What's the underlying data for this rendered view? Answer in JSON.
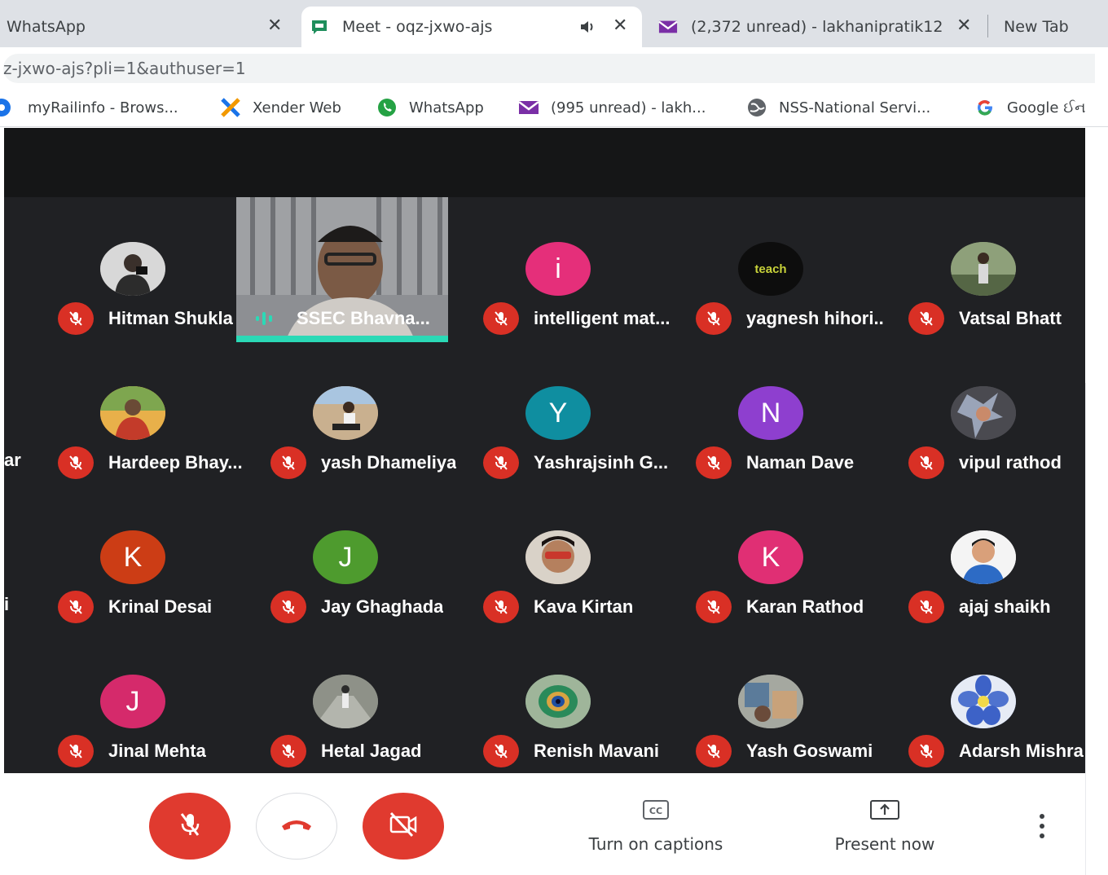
{
  "browser": {
    "tabs": [
      {
        "title": "WhatsApp",
        "icon": "whatsapp-icon"
      },
      {
        "title": "Meet - oqz-jxwo-ajs",
        "icon": "meet-icon",
        "active": true,
        "audio": true
      },
      {
        "title": "(2,372 unread) - lakhanipratik12",
        "icon": "gmail-icon"
      },
      {
        "title": "New Tab"
      }
    ],
    "url": "z-jxwo-ajs?pli=1&authuser=1",
    "bookmarks": [
      {
        "label": "myRailinfo - Brows...",
        "icon": "railinfo-icon"
      },
      {
        "label": "Xender Web",
        "icon": "xender-icon"
      },
      {
        "label": "WhatsApp",
        "icon": "whatsapp-icon"
      },
      {
        "label": "(995 unread) - lakh...",
        "icon": "gmail-icon"
      },
      {
        "label": "NSS-National Servi...",
        "icon": "globe-icon"
      },
      {
        "label": "Google ઈન",
        "icon": "google-icon"
      }
    ]
  },
  "meet": {
    "speaker": {
      "name": "SSEC Bhavna..."
    },
    "participants": [
      {
        "name": "Hitman Shukla",
        "initial": "",
        "color": "#6f6a66"
      },
      {
        "name": "intelligent mat...",
        "initial": "i",
        "color": "#e52f7a"
      },
      {
        "name": "yagnesh hihori...",
        "initial": "teach",
        "color": "#0d0d0d"
      },
      {
        "name": "Vatsal Bhatt",
        "initial": "",
        "color": "#6d7d5a"
      },
      {
        "name": "Hardeep Bhay...",
        "initial": "",
        "color": "#d2892f"
      },
      {
        "name": "yash Dhameliya",
        "initial": "",
        "color": "#b39472"
      },
      {
        "name": "Yashrajsinh G...",
        "initial": "Y",
        "color": "#0f8ea0"
      },
      {
        "name": "Naman Dave",
        "initial": "N",
        "color": "#8e3fcf"
      },
      {
        "name": "vipul rathod",
        "initial": "",
        "color": "#55545a"
      },
      {
        "name": "Krinal Desai",
        "initial": "K",
        "color": "#cc3d15"
      },
      {
        "name": "Jay Ghaghada",
        "initial": "J",
        "color": "#4e9b2e"
      },
      {
        "name": "Kava Kirtan",
        "initial": "",
        "color": "#8a6d5a"
      },
      {
        "name": "Karan Rathod",
        "initial": "K",
        "color": "#e02f74"
      },
      {
        "name": "ajaj shaikh",
        "initial": "",
        "color": "#f0f0f0"
      },
      {
        "name": "Jinal Mehta",
        "initial": "J",
        "color": "#d52a6b"
      },
      {
        "name": "Hetal Jagad",
        "initial": "",
        "color": "#7c7f78"
      },
      {
        "name": "Renish Mavani",
        "initial": "",
        "color": "#4d7a6a"
      },
      {
        "name": "Yash Goswami",
        "initial": "",
        "color": "#8a8a86"
      },
      {
        "name": "Adarsh Mishra",
        "initial": "",
        "color": "#4f73cf"
      }
    ],
    "cut_names": [
      "ar",
      "i"
    ],
    "controls": {
      "captions_label": "Turn on captions",
      "present_label": "Present now"
    }
  }
}
